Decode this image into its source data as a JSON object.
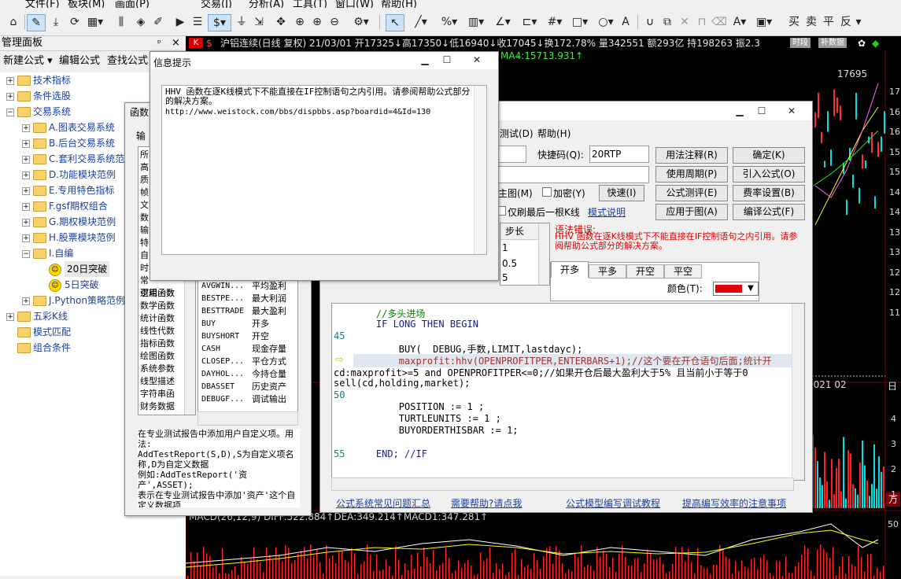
{
  "menu": [
    "文件(F)",
    "板块(M)",
    "画面(P)",
    "交易(J)",
    "分析(A)",
    "工具(T)",
    "窗口(W)",
    "帮助(H)"
  ],
  "toolbar": {
    "trade_labels": [
      "买",
      "卖",
      "平",
      "反"
    ]
  },
  "left_panel": {
    "title": "管理面板",
    "pin": "ᵖ",
    "close": "×",
    "tabs": [
      "新建公式 ▾",
      "编辑公式",
      "查找公式"
    ],
    "tree": [
      {
        "label": "技术指标",
        "level": 0,
        "expand": "+"
      },
      {
        "label": "条件选股",
        "level": 0,
        "expand": "+"
      },
      {
        "label": "交易系统",
        "level": 0,
        "expand": "−"
      },
      {
        "label": "A.图表交易系统",
        "level": 1,
        "expand": "+"
      },
      {
        "label": "B.后台交易系统",
        "level": 1,
        "expand": "+"
      },
      {
        "label": "C.套利交易系统范例",
        "level": 1,
        "expand": "+"
      },
      {
        "label": "D.功能模块范例",
        "level": 1,
        "expand": "+"
      },
      {
        "label": "E.专用特色指标",
        "level": 1,
        "expand": "+"
      },
      {
        "label": "F.gsf期权组合",
        "level": 1,
        "expand": "+"
      },
      {
        "label": "G.期权模块范例",
        "level": 1,
        "expand": "+"
      },
      {
        "label": "H.股票模块范例",
        "level": 1,
        "expand": "+"
      },
      {
        "label": "I.自编",
        "level": 1,
        "expand": "−"
      },
      {
        "label": "20日突破",
        "level": 2,
        "expand": ""
      },
      {
        "label": "5日突破",
        "level": 2,
        "expand": ""
      },
      {
        "label": "J.Python策略范例",
        "level": 1,
        "expand": "+"
      },
      {
        "label": "五彩K线",
        "level": 0,
        "expand": "+"
      },
      {
        "label": "模式匹配",
        "level": 0,
        "expand": ""
      },
      {
        "label": "组合条件",
        "level": 0,
        "expand": ""
      }
    ]
  },
  "chart": {
    "header": "沪铝连续(日线 复权) 21/03/01 开17325↓高17350↓低16940↓收17045↓换172.78% 量342551 额293亿 持198263 振2.3",
    "ma_label": "MA4:15713.931↑",
    "price_label": "17695",
    "badges": [
      "时段",
      "补数据"
    ],
    "right_axis": [
      "17",
      "16",
      "16",
      "15",
      "15",
      "14",
      "14",
      "13",
      "13",
      "12",
      "12",
      "11"
    ],
    "date_label": "2021 02",
    "date_right": "日",
    "macd_label": "MACD(26,12,9) DIFF:522.884↑DEA:349.214↑MACD1:347.281↑",
    "vol_axis": [
      "4",
      "3",
      "2",
      "1"
    ],
    "vol_unit": "万",
    "macd_axis": "50"
  },
  "info_dialog": {
    "title": "信息提示",
    "message": "HHV 函数在逐K线模式下不能直接在IF控制语句之内引用。请参阅帮助公式部分的解决方案。",
    "url": "http://www.weistock.com/bbs/dispbbs.asp?boardid=4&Id=130"
  },
  "func_dialog": {
    "title": "函数",
    "input_label": "输",
    "categories": [
      "逻辑函数",
      "数学函数",
      "统计函数",
      "线性代数",
      "指标函数",
      "绘图函数",
      "系统参数",
      "线型描述",
      "字符串函",
      "财务数据"
    ],
    "partial_top": [
      "所",
      "高",
      "质",
      "帧",
      "文",
      "数",
      "输",
      "特",
      "自",
      "时",
      "常",
      "引用函数"
    ],
    "functions": [
      {
        "name": "AVGWIN...",
        "desc": "平均盈利"
      },
      {
        "name": "BESTPE...",
        "desc": "最大利润"
      },
      {
        "name": "BESTTRADE",
        "desc": "最大盈利"
      },
      {
        "name": "BUY",
        "desc": "开多"
      },
      {
        "name": "BUYSHORT",
        "desc": "开空"
      },
      {
        "name": "CASH",
        "desc": "现金存量"
      },
      {
        "name": "CLOSEP...",
        "desc": "平仓方式"
      },
      {
        "name": "DAYHOL...",
        "desc": "今持仓量"
      },
      {
        "name": "DBASSET",
        "desc": "历史资产"
      },
      {
        "name": "DEBUGF...",
        "desc": "调试输出"
      }
    ],
    "description": "在专业测试报告中添加用户自定义项。用法:\nAddTestReport(S,D),S为自定义项名称,D为自定义数据\n例如:AddTestReport('资产',ASSET);\n表示在专业测试报告中添加'资产'这个自定义数据项\n所属函数组:交易系统"
  },
  "editor": {
    "menu_partial": [
      "测试(D)",
      "帮助(H)"
    ],
    "quick_code_label": "快捷码(Q):",
    "quick_code_value": "20RTP",
    "buttons": [
      "用法注释(R)",
      "确定(K)",
      "使用周期(P)",
      "引入公式(O)",
      "公式测评(E)",
      "费率设置(B)",
      "应用于图(A)",
      "编译公式(F)",
      "快速(I)"
    ],
    "encrypt_label": "加密(Y)",
    "last_bar_label": "仅刷最后一根K线",
    "mode_link": "模式说明",
    "main_chart_label": "主图(M)",
    "param_header": "步长",
    "param_values": [
      "1",
      "0.5",
      "5"
    ],
    "error_title": "语法错误:",
    "error_msg": "HHV 函数在逐K线模式下不能直接在IF控制语句之内引用。请参阅帮助公式部分的解决方案。",
    "signal_tabs": [
      "开多",
      "平多",
      "开空",
      "平空"
    ],
    "color_label": "颜色(T):",
    "color_value": "#e00000",
    "code_lines": [
      {
        "ln": "",
        "text": "    //多头进场",
        "cls": "comment"
      },
      {
        "ln": "",
        "text": "    IF LONG THEN BEGIN",
        "cls": "kw"
      },
      {
        "ln": "45",
        "text": "",
        "cls": ""
      },
      {
        "ln": "",
        "text": "        BUY( _DEBUG,手数,LIMIT,lastdayc);",
        "cls": ""
      },
      {
        "ln": "",
        "text": "        maxprofit:hhv(OPENPROFITPER,ENTERBARS+1);//这个要在开仓语句后面;统计开",
        "cls": "hl"
      },
      {
        "ln": "",
        "text": "cd:maxprofit>=5 and OPENPROFITPER<=0;//如果开仓后最大盈利大于5% 且当前小于等于0",
        "cls": ""
      },
      {
        "ln": "",
        "text": "sell(cd,holding,market);",
        "cls": ""
      },
      {
        "ln": "50",
        "text": "",
        "cls": ""
      },
      {
        "ln": "",
        "text": "        POSITION := 1 ;",
        "cls": ""
      },
      {
        "ln": "",
        "text": "        TURTLEUNITS := 1 ;",
        "cls": ""
      },
      {
        "ln": "",
        "text": "        BUYORDERTHISBAR := 1;",
        "cls": ""
      },
      {
        "ln": "",
        "text": "",
        "cls": ""
      },
      {
        "ln": "55",
        "text": "    END; //IF",
        "cls": "kw"
      }
    ],
    "bottom_links": [
      "公式系统常见问题汇总",
      "需要帮助?请点我",
      "公式模型编写调试教程",
      "提高编写效率的注意事项"
    ]
  }
}
